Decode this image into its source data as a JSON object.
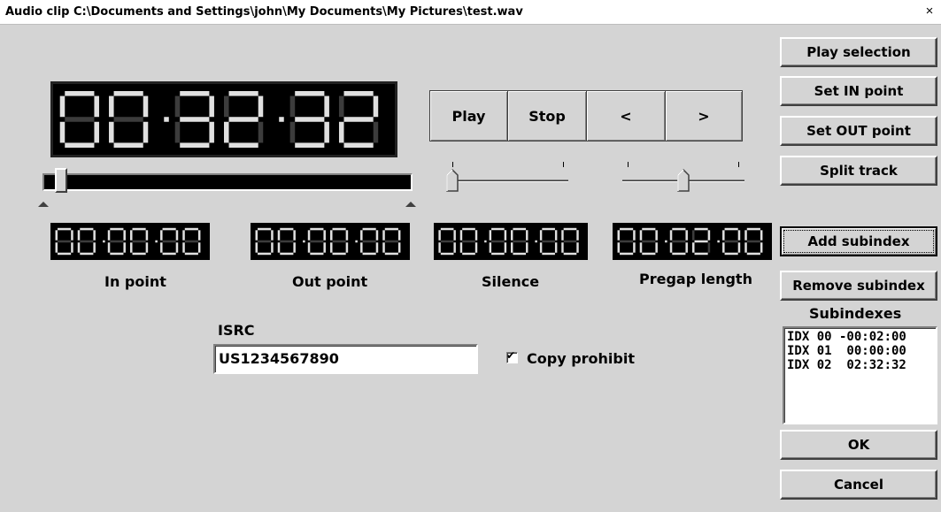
{
  "window": {
    "title": "Audio clip C:\\Documents and Settings\\john\\My Documents\\My Pictures\\test.wav",
    "close_glyph": "×"
  },
  "main_display": {
    "time": "00:32:32"
  },
  "transport": {
    "play": "Play",
    "stop": "Stop",
    "prev": "<",
    "next": ">"
  },
  "counters": [
    {
      "label": "In point",
      "value": "00:00:00"
    },
    {
      "label": "Out point",
      "value": "00:00:00"
    },
    {
      "label": "Silence",
      "value": "00:00:00"
    },
    {
      "label": "Pregap length",
      "value": "00:02:00"
    }
  ],
  "position": {
    "fraction": 0.03
  },
  "volume": {
    "fraction": 0.0
  },
  "balance": {
    "fraction": 0.5
  },
  "isrc": {
    "label": "ISRC",
    "value": "US1234567890"
  },
  "copy_prohibit": {
    "label": "Copy prohibit",
    "checked": true,
    "check_glyph": "✔"
  },
  "side": {
    "play_selection": "Play selection",
    "set_in": "Set IN point",
    "set_out": "Set OUT point",
    "split": "Split track",
    "add_subindex": "Add subindex",
    "remove_subindex": "Remove subindex",
    "subindexes_label": "Subindexes",
    "ok": "OK",
    "cancel": "Cancel"
  },
  "subindexes": [
    "IDX 00 -00:02:00",
    "IDX 01  00:00:00",
    "IDX 02  02:32:32"
  ],
  "colors": {
    "lcd_on": "#e0e0e0",
    "lcd_off": "#3c3c3c",
    "face": "#d4d4d4"
  }
}
